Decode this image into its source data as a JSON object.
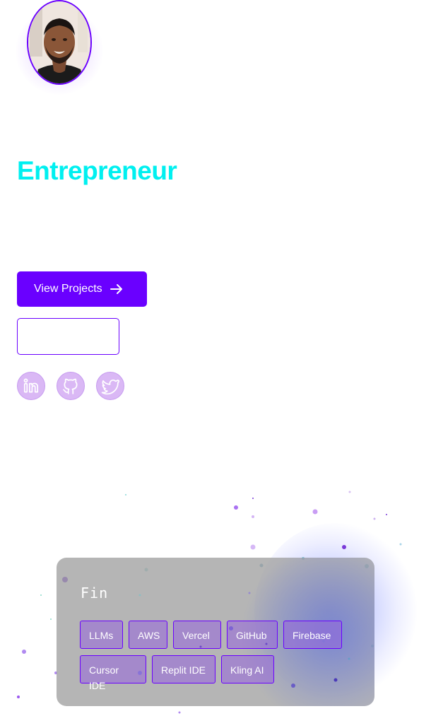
{
  "hero": {
    "title": "Entrepreneur"
  },
  "actions": {
    "primary_label": "View Projects",
    "secondary_label": ""
  },
  "social": [
    {
      "name": "linkedin-icon"
    },
    {
      "name": "github-icon"
    },
    {
      "name": "twitter-icon"
    }
  ],
  "card": {
    "title": "Fin",
    "tags": [
      "LLMs",
      "AWS",
      "Vercel",
      "GitHub",
      "Firebase",
      "Cursor IDE",
      "Replit IDE",
      "Kling AI"
    ]
  },
  "colors": {
    "accent": "#6a00ff",
    "title": "#00f0f0",
    "social_bg": "#dab8f5",
    "card_bg": "#a0a0a0"
  }
}
